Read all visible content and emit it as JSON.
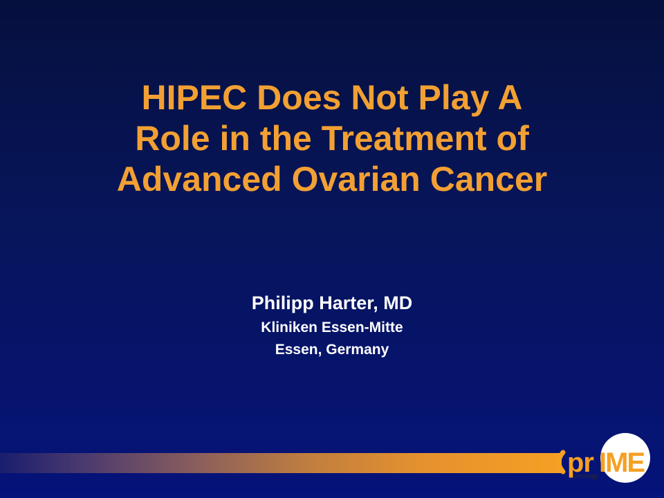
{
  "title": {
    "lines": [
      "HIPEC Does Not Play A",
      "Role in the Treatment of",
      "Advanced Ovarian Cancer"
    ]
  },
  "presenter": {
    "name": "Philipp Harter, MD",
    "institution": "Kliniken Essen-Mitte",
    "location": "Essen, Germany"
  },
  "logo": {
    "brand": "prIME",
    "tagline": "oncology"
  },
  "colors": {
    "title": "#f2a033",
    "text": "#ffffff",
    "background_top": "#06103e",
    "background_bottom": "#05137a",
    "accent_orange": "#f5a023"
  }
}
